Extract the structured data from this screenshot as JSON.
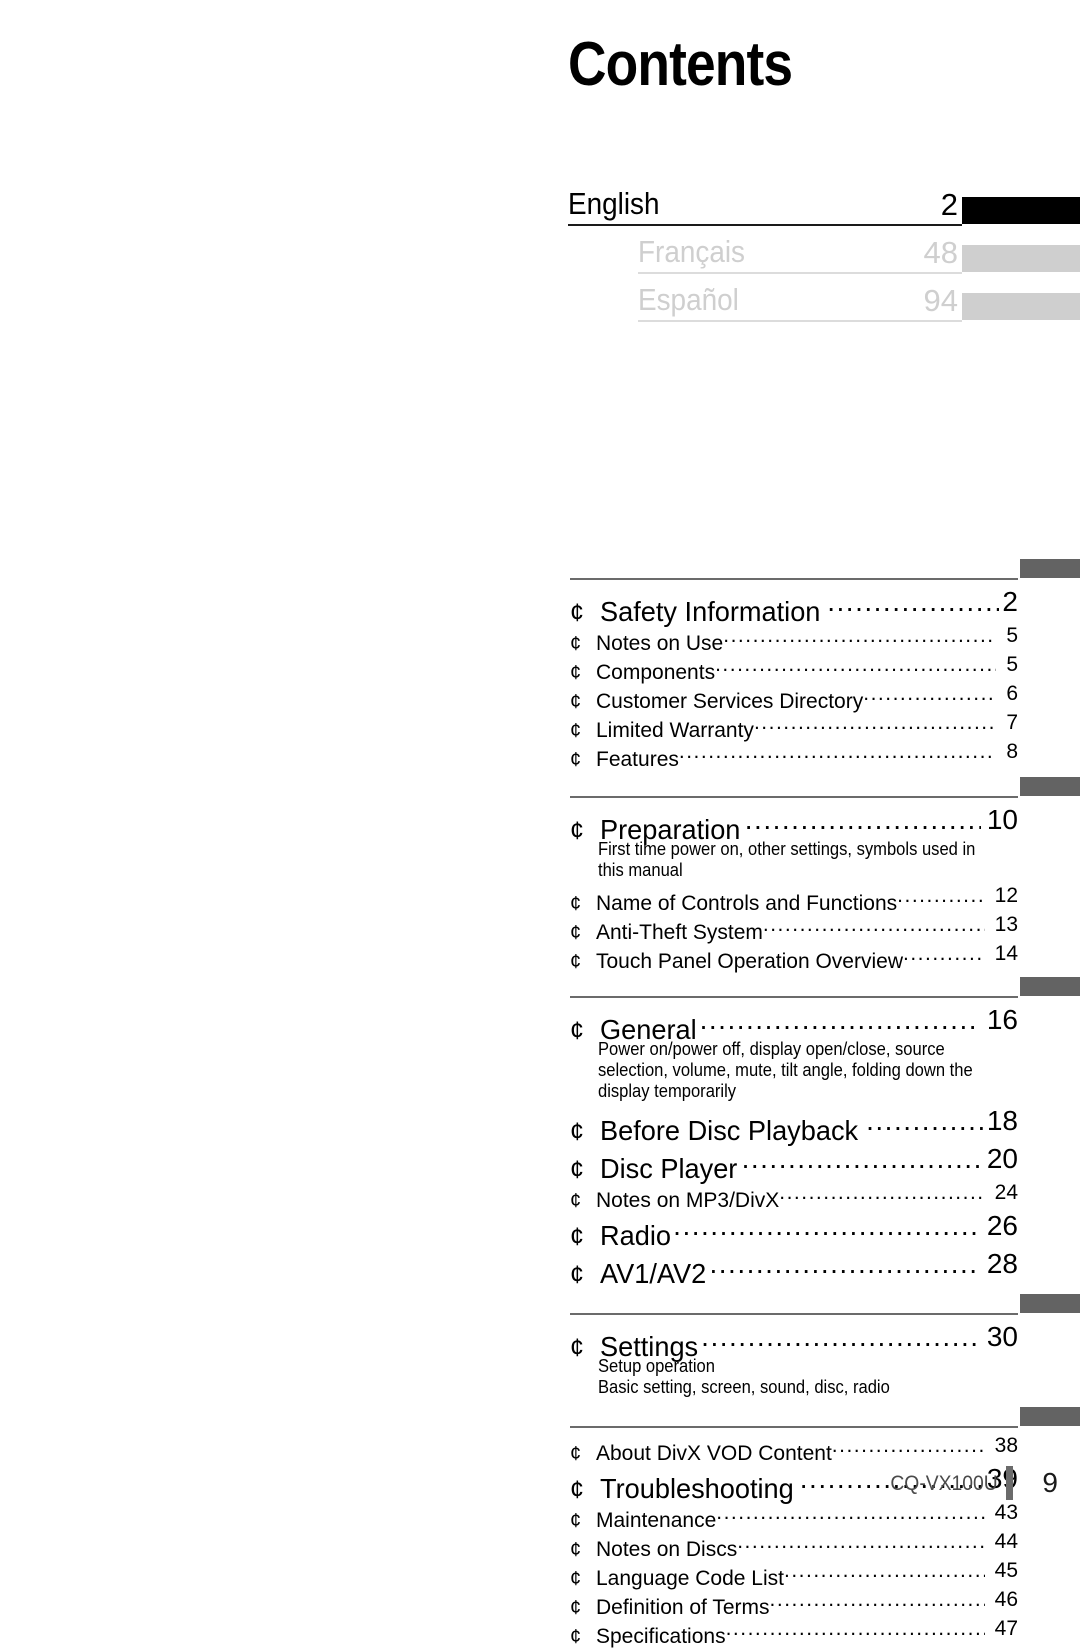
{
  "title": "Contents",
  "bullet_glyph": "¢",
  "colors": {
    "active_tab": "#000000",
    "inactive_tab": "#cfcfcf",
    "section_tab": "#636363",
    "rule": "#6b6b6b",
    "inactive_text": "#cfcfcf"
  },
  "languages": [
    {
      "name": "English",
      "page": "2",
      "active": true
    },
    {
      "name": "Français",
      "page": "48",
      "active": false
    },
    {
      "name": "Español",
      "page": "94",
      "active": false
    }
  ],
  "sections": [
    {
      "entries": [
        {
          "label": "Safety Information",
          "page": "2",
          "level": "major"
        },
        {
          "label": "Notes on Use",
          "page": "5",
          "level": "minor"
        },
        {
          "label": "Components",
          "page": "5",
          "level": "minor"
        },
        {
          "label": "Customer Services Directory",
          "page": "6",
          "level": "minor"
        },
        {
          "label": "Limited Warranty",
          "page": "7",
          "level": "minor"
        },
        {
          "label": "Features",
          "page": "8",
          "level": "minor"
        }
      ]
    },
    {
      "entries": [
        {
          "label": "Preparation",
          "page": "10",
          "level": "major",
          "desc": "First time power on, other settings, symbols used in this manual"
        },
        {
          "label": "Name of Controls and Functions",
          "page": "12",
          "level": "minor"
        },
        {
          "label": "Anti-Theft System",
          "page": "13",
          "level": "minor"
        },
        {
          "label": "Touch Panel Operation Overview",
          "page": "14",
          "level": "minor"
        }
      ]
    },
    {
      "entries": [
        {
          "label": "General",
          "page": "16",
          "level": "major",
          "desc": "Power on/power off, display open/close, source selection, volume, mute, tilt angle, folding down the display temporarily"
        },
        {
          "label": "Before Disc Playback",
          "page": "18",
          "level": "major"
        },
        {
          "label": "Disc Player",
          "page": "20",
          "level": "major"
        },
        {
          "label": "Notes on MP3/DivX",
          "page": "24",
          "level": "minor"
        },
        {
          "label": "Radio",
          "page": "26",
          "level": "major"
        },
        {
          "label": "AV1/AV2",
          "page": "28",
          "level": "major"
        }
      ]
    },
    {
      "entries": [
        {
          "label": "Settings",
          "page": "30",
          "level": "major",
          "desc": "Setup operation\nBasic setting, screen, sound, disc, radio"
        }
      ]
    },
    {
      "entries": [
        {
          "label": "About DivX VOD Content",
          "page": "38",
          "level": "minor"
        },
        {
          "label": "Troubleshooting",
          "page": "39",
          "level": "major"
        },
        {
          "label": "Maintenance",
          "page": "43",
          "level": "minor"
        },
        {
          "label": "Notes on Discs",
          "page": "44",
          "level": "minor"
        },
        {
          "label": "Language Code List",
          "page": "45",
          "level": "minor"
        },
        {
          "label": "Definition of Terms",
          "page": "46",
          "level": "minor"
        },
        {
          "label": "Specifications",
          "page": "47",
          "level": "minor"
        }
      ]
    }
  ],
  "footer": {
    "model": "CQ-VX100U",
    "page_number": "9"
  }
}
